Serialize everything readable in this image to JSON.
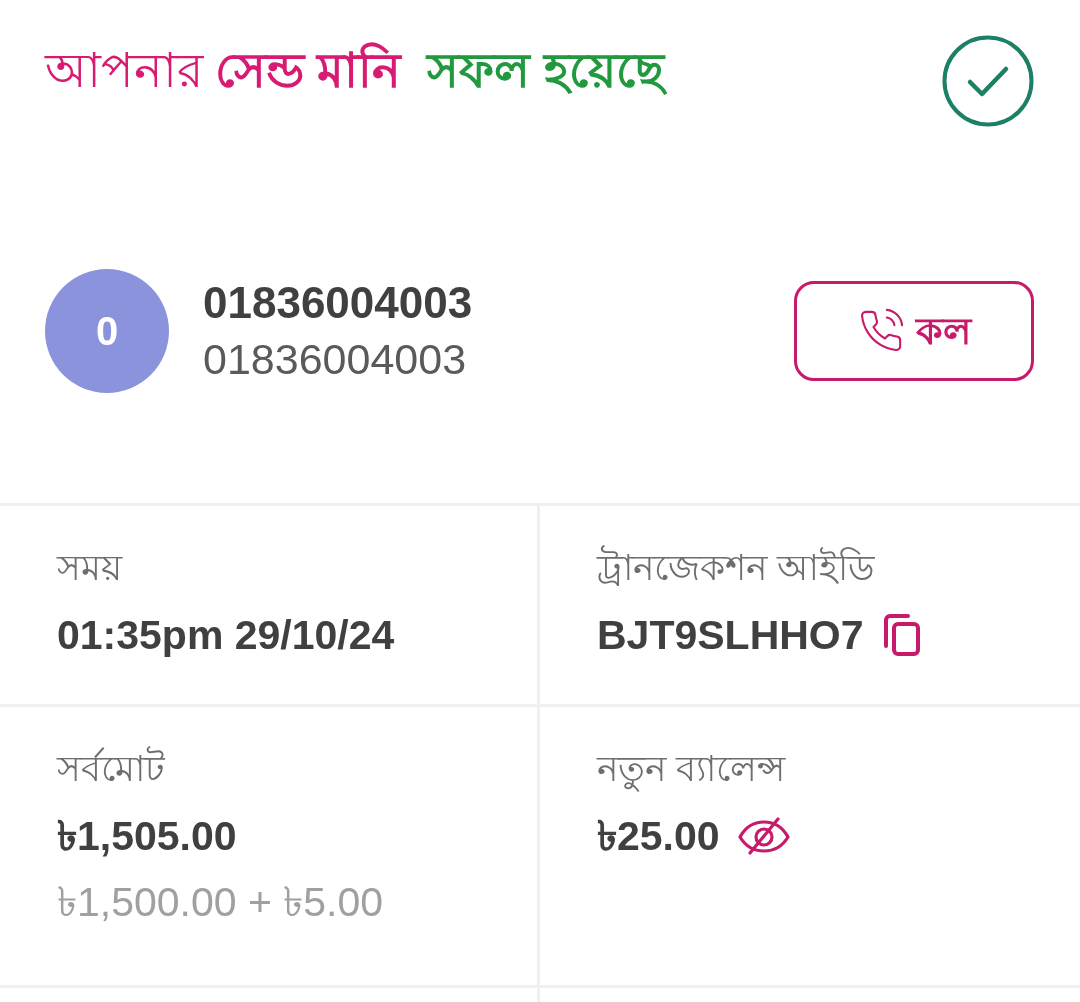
{
  "header": {
    "title": [
      {
        "text": "আপনার",
        "bold": false,
        "color": "#d81b72"
      },
      {
        "text": "সেন্ড মানি",
        "bold": true,
        "color": "#d81b72"
      },
      {
        "text": "সফল হয়েছে",
        "bold": true,
        "color": "#22993f"
      }
    ]
  },
  "recipient": {
    "avatar_initial": "0",
    "name": "01836004003",
    "number": "01836004003",
    "call_button": "কল"
  },
  "details": [
    {
      "kind": "plain",
      "label": "সময়",
      "value": "01:35pm 29/10/24"
    },
    {
      "kind": "copyable",
      "label": "ট্রানজেকশন আইডি",
      "value": "BJT9SLHHO7"
    },
    {
      "kind": "plain",
      "label": "সর্বমোট",
      "value": "৳1,505.00",
      "breakdown": "৳1,500.00 + ৳5.00"
    },
    {
      "kind": "concealable",
      "label": "নতুন ব্যালেন্স",
      "value": "৳25.00"
    }
  ]
}
